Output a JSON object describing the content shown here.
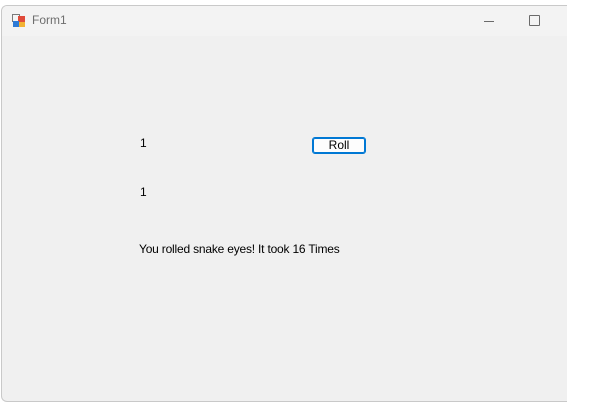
{
  "window": {
    "title": "Form1",
    "icon": "winforms-app-icon",
    "minimize_icon": "minimize-icon",
    "maximize_icon": "maximize-icon"
  },
  "form": {
    "die1_value": "1",
    "die2_value": "1",
    "roll_button_label": "Roll",
    "result_text": "You rolled snake eyes! It took 16 Times"
  },
  "colors": {
    "form_background": "#f0f0f0",
    "button_accent": "#0078d4"
  }
}
